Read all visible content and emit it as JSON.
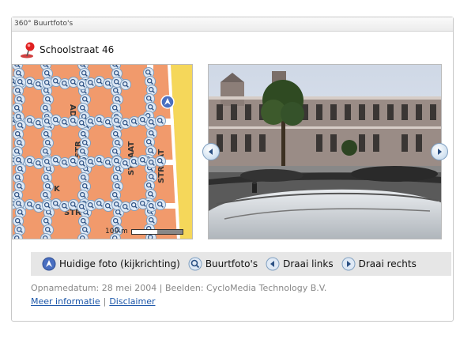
{
  "window": {
    "title": "360° Buurtfoto's"
  },
  "address": {
    "title": "Schoolstraat 46",
    "icon": "red-pin-icon"
  },
  "map": {
    "street_labels": [
      "AD",
      "STRAAT",
      "K",
      "STR",
      "STRAAT",
      "STR"
    ],
    "scale_label": "100 m"
  },
  "photo": {
    "prev_icon": "chevron-left-icon",
    "next_icon": "chevron-right-icon"
  },
  "legend": {
    "current_label": "Huidige foto (kijkrichting)",
    "nearby_label": "Buurtfoto's",
    "rotate_left_label": "Draai links",
    "rotate_right_label": "Draai rechts"
  },
  "meta": {
    "text": "Opnamedatum: 28 mei 2004 | Beelden: CycloMedia Technology B.V."
  },
  "links": {
    "more_info": "Meer informatie",
    "separator": "|",
    "disclaimer": "Disclaimer"
  },
  "colors": {
    "map_bg": "#f19a6c",
    "road": "#ffffff",
    "main_road": "#f5d75a",
    "marker_blue": "#4a6fc0",
    "link": "#1a55a8"
  }
}
